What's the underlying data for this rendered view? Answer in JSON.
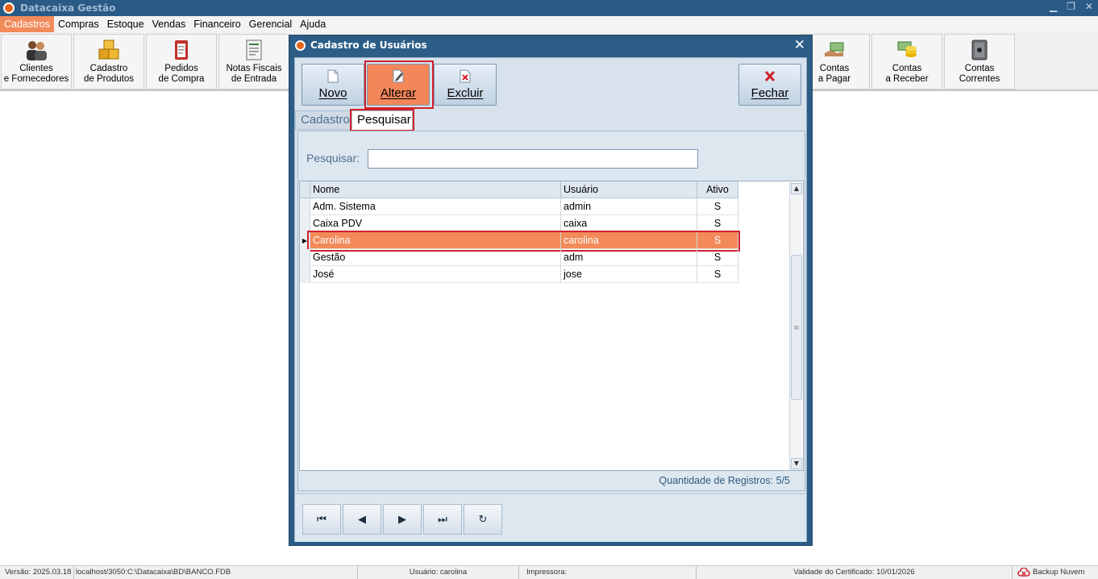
{
  "app": {
    "title": "Datacaixa Gestão"
  },
  "menu": [
    {
      "label": "Cadastros",
      "active": true
    },
    {
      "label": "Compras"
    },
    {
      "label": "Estoque"
    },
    {
      "label": "Vendas"
    },
    {
      "label": "Financeiro"
    },
    {
      "label": "Gerencial"
    },
    {
      "label": "Ajuda"
    }
  ],
  "toolbar": {
    "clientes": {
      "line1": "Clientes",
      "line2": "e Fornecedores",
      "icon": "people-icon"
    },
    "produtos": {
      "line1": "Cadastro",
      "line2": "de Produtos",
      "icon": "boxes-icon"
    },
    "pedidos": {
      "line1": "Pedidos",
      "line2": "de Compra",
      "icon": "clipboard-icon"
    },
    "notas": {
      "line1": "Notas Fiscais",
      "line2": "de Entrada",
      "icon": "invoice-icon"
    },
    "pagar": {
      "line1": "Contas",
      "line2": "a Pagar",
      "icon": "hand-money-icon"
    },
    "receber": {
      "line1": "Contas",
      "line2": "a Receber",
      "icon": "coins-icon"
    },
    "correntes": {
      "line1": "Contas",
      "line2": "Correntes",
      "icon": "safe-icon"
    }
  },
  "dialog": {
    "title": "Cadastro de Usuários",
    "close": "✕",
    "actions": {
      "novo": "Novo",
      "alterar": "Alterar",
      "excluir": "Excluir",
      "fechar": "Fechar"
    },
    "tabs": {
      "cadastro": "Cadastro",
      "pesquisar": "Pesquisar"
    },
    "search": {
      "label": "Pesquisar:",
      "value": ""
    },
    "grid": {
      "columns": {
        "nome": "Nome",
        "usuario": "Usuário",
        "ativo": "Ativo"
      },
      "rows": [
        {
          "nome": "Adm. Sistema",
          "usuario": "admin",
          "ativo": "S"
        },
        {
          "nome": "Caixa PDV",
          "usuario": "caixa",
          "ativo": "S"
        },
        {
          "nome": "Carolina",
          "usuario": "carolina",
          "ativo": "S",
          "selected": true
        },
        {
          "nome": "Gestão",
          "usuario": "adm",
          "ativo": "S"
        },
        {
          "nome": "José",
          "usuario": "jose",
          "ativo": "S"
        }
      ]
    },
    "count": "Quantidade de Registros: 5/5",
    "nav": {
      "first": "⏮",
      "prev": "◀",
      "next": "▶",
      "last": "⏭",
      "refresh": "↻"
    }
  },
  "status": {
    "versao": "Versão: 2025.03.18",
    "banco": "localhost/3050:C:\\Datacaixa\\BD\\BANCO.FDB",
    "usuario": "Usuário: carolina",
    "impressora": "Impressora:",
    "certificado": "Validade do Certificado: 10/01/2026",
    "backup": "Backup Nuvem"
  },
  "colors": {
    "accent": "#f28a5a",
    "dialog_frame": "#2c5d87",
    "highlight_outline": "#d2202c"
  }
}
